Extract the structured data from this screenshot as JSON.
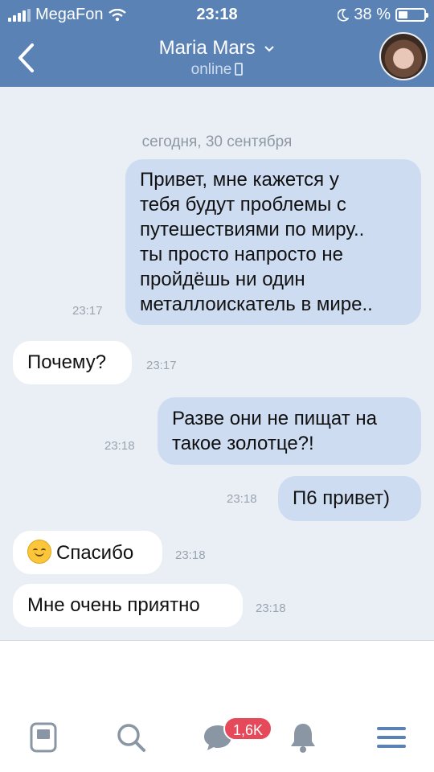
{
  "status_bar": {
    "carrier": "MegaFon",
    "time": "23:18",
    "battery_text": "38 %",
    "battery_level": 0.38
  },
  "header": {
    "contact_name": "Maria Mars",
    "contact_status": "online",
    "icons": [
      "back-icon",
      "chevron-down-icon",
      "phone-icon",
      "avatar"
    ],
    "bg_color": "#5b82b5"
  },
  "chat": {
    "date_separator": "сегодня, 30 сентября",
    "messages": [
      {
        "direction": "out",
        "lines": [
          "Привет, мне кажется у",
          "тебя будут проблемы с",
          "путешествиями по миру..",
          "ты просто напросто не",
          "пройдёшь ни один",
          "металлоискатель в мире.."
        ],
        "time": "23:17"
      },
      {
        "direction": "in",
        "lines": [
          "Почему?"
        ],
        "time": "23:17"
      },
      {
        "direction": "out",
        "lines": [
          "Разве они не пищат на",
          "такое золотце?!"
        ],
        "time": "23:18"
      },
      {
        "direction": "out",
        "lines": [
          "П6 привет)"
        ],
        "time": "23:18"
      },
      {
        "direction": "in",
        "lines": [
          "Спасибо"
        ],
        "emoji": "smiling-face",
        "time": "23:18"
      },
      {
        "direction": "in",
        "lines": [
          "Мне очень приятно"
        ],
        "time": "23:18"
      }
    ]
  },
  "bottom_nav": {
    "items": [
      "news-icon",
      "search-icon",
      "messages-icon",
      "notifications-icon",
      "menu-icon"
    ],
    "messages_badge": "1,6K",
    "icon_color": "#5b82b5"
  }
}
